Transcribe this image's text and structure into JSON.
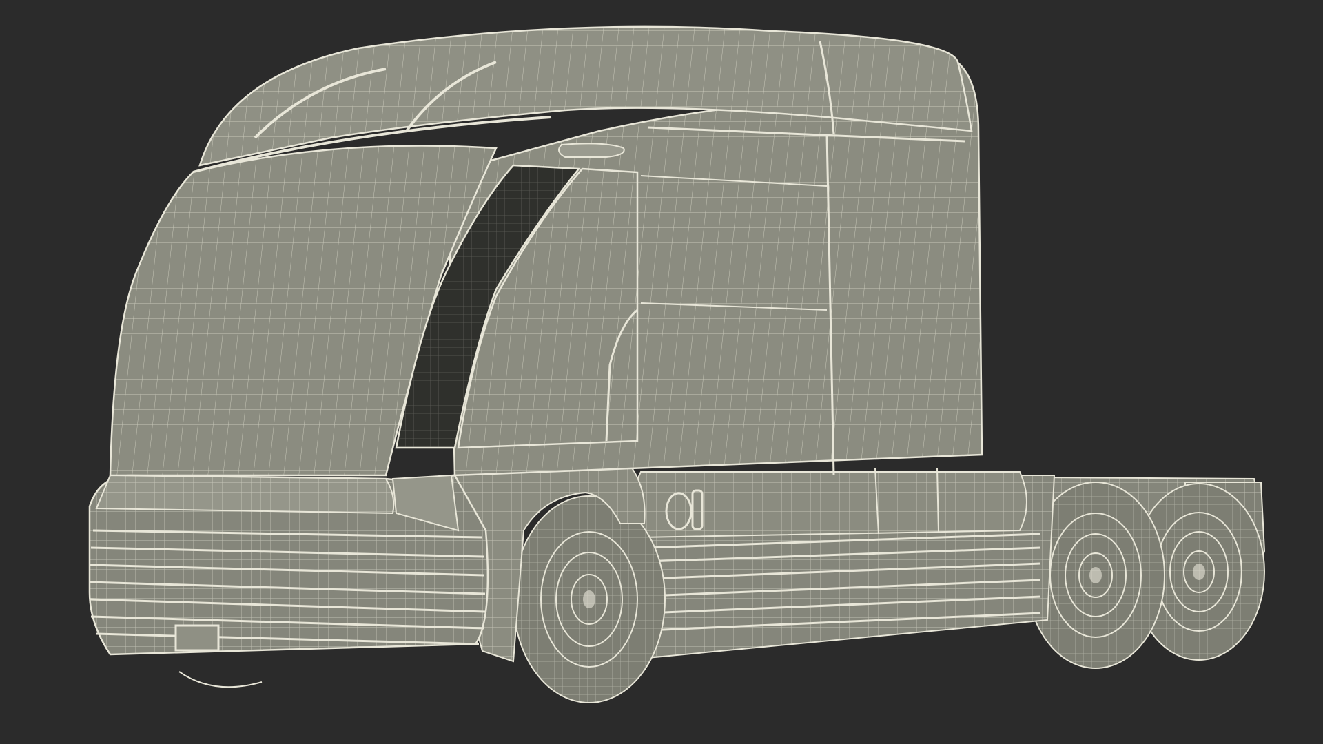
{
  "scene": {
    "subject": "wireframe-truck-render",
    "colors": {
      "background": "#2b2b2b",
      "body_fill": "#8b8c80",
      "body_fill_dark": "#6f7067",
      "wire": "#e8e6d8",
      "wire_soft": "#cfcdbd",
      "cavity": "#2f302c",
      "tire_fill": "#7d7e73"
    }
  }
}
